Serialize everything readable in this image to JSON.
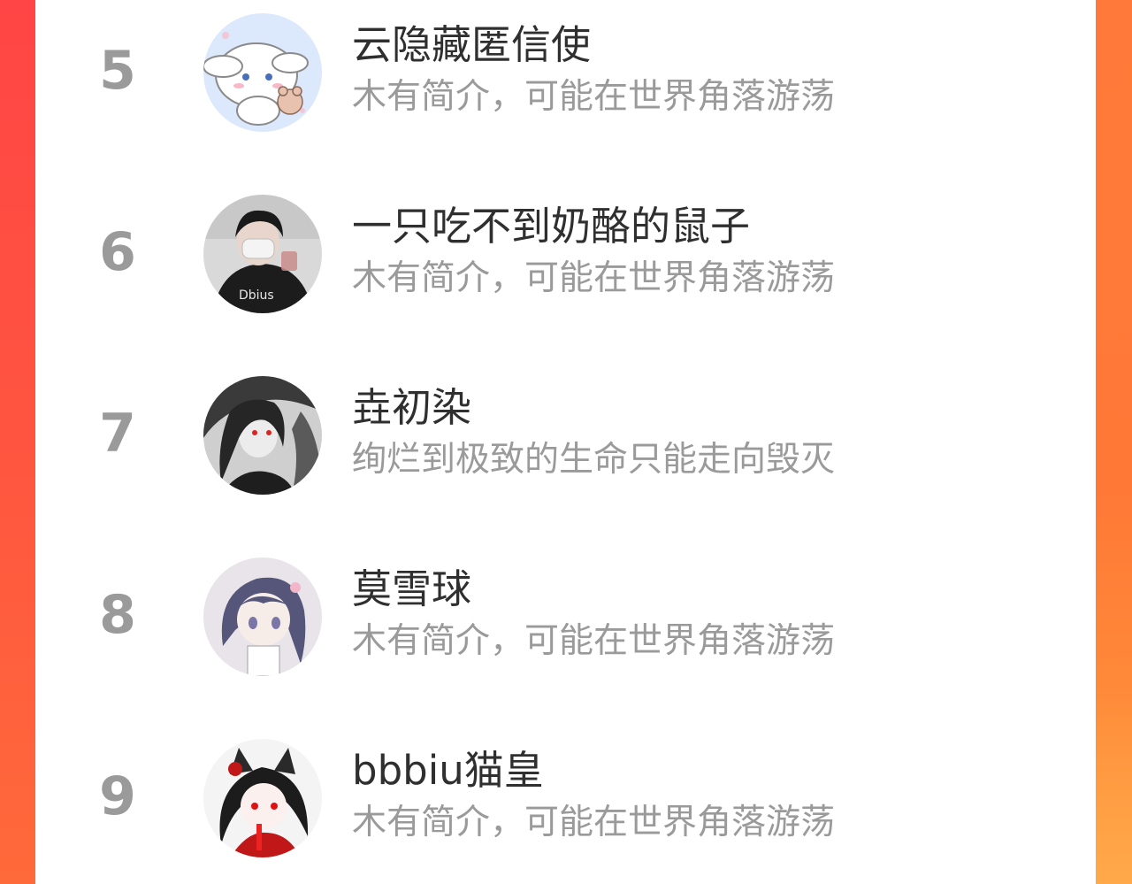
{
  "ranking": {
    "entries": [
      {
        "rank": "5",
        "name": "云隐藏匿信使",
        "bio": "木有简介，可能在世界角落游荡",
        "avatar_icon": "cinnamoroll-avatar-icon"
      },
      {
        "rank": "6",
        "name": "一只吃不到奶酪的鼠子",
        "bio": "木有简介，可能在世界角落游荡",
        "avatar_icon": "masked-boy-avatar-icon"
      },
      {
        "rank": "7",
        "name": "垚初染",
        "bio": "绚烂到极致的生命只能走向毁灭",
        "avatar_icon": "anime-dark-avatar-icon"
      },
      {
        "rank": "8",
        "name": "莫雪球",
        "bio": "木有简介，可能在世界角落游荡",
        "avatar_icon": "anime-girl-avatar-icon"
      },
      {
        "rank": "9",
        "name": "bbbiu猫皇",
        "bio": "木有简介，可能在世界角落游荡",
        "avatar_icon": "cat-girl-avatar-icon"
      }
    ]
  },
  "colors": {
    "background_gradient_start": "#ff4a45",
    "background_gradient_end": "#ff8a3a",
    "rank_color": "#9a9a9a",
    "name_color": "#2f2f2f",
    "bio_color": "#9a9a9a"
  }
}
